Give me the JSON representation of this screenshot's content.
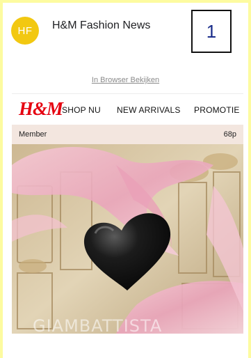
{
  "email": {
    "avatar_initials": "HF",
    "sender_name": "H&M Fashion News",
    "index_label": "1",
    "browser_link": "In Browser Bekijken"
  },
  "brand": {
    "logo_text": "H&M",
    "accent_color": "#e50010"
  },
  "nav": {
    "items": [
      "SHOP NU",
      "NEW ARRIVALS",
      "PROMOTIE"
    ]
  },
  "member": {
    "label": "Member",
    "points": "68p"
  },
  "hero": {
    "caption": "GIAMBATTISTA"
  }
}
